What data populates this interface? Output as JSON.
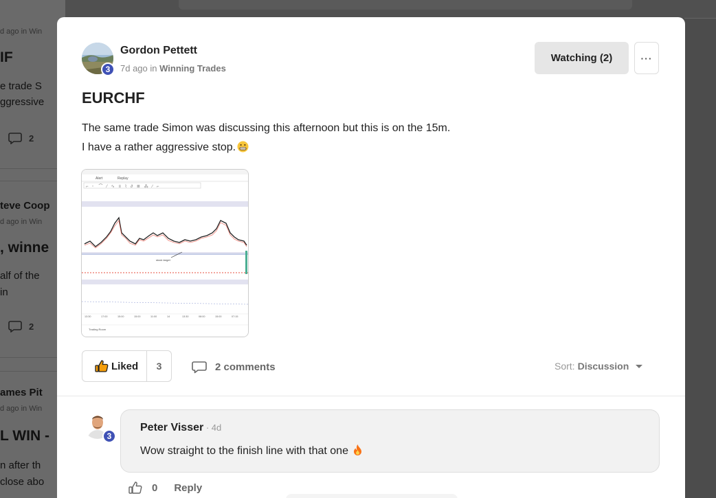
{
  "background_feed": {
    "cards": [
      {
        "meta": "d ago in Win",
        "title": "IF",
        "lines": [
          "e trade S",
          "ggressive"
        ],
        "comments": "2"
      },
      {
        "name": "teve Coop",
        "meta": "d ago in Win",
        "title": ", winne",
        "lines": [
          "alf of the",
          "in"
        ],
        "comments": "2"
      },
      {
        "name": "ames Pit",
        "meta": "d ago in Win",
        "title": "L WIN -",
        "lines": [
          "n after th",
          "close abo"
        ]
      }
    ]
  },
  "post": {
    "author": "Gordon Pettett",
    "level": "3",
    "time": "7d ago in",
    "group": "Winning Trades",
    "title": "EURCHF",
    "body_lines": [
      "The same trade Simon was discussing this afternoon but this is on the 15m.",
      "I have a rather aggressive stop."
    ]
  },
  "header_actions": {
    "watching_label": "Watching (2)",
    "more_icon": "ellipsis-icon"
  },
  "chart_preview": {
    "toolbar_items": [
      "Alert",
      "Replay"
    ],
    "annotation": "stock target",
    "footer_label": "Trading Room",
    "x_ticks": [
      "13:30",
      "17:00",
      "15:00",
      "15:00",
      "11:00",
      "14",
      "13:30",
      "08:00",
      "15:00",
      "07:15"
    ]
  },
  "reactions": {
    "liked_label": "Liked",
    "liked_count": "3",
    "comments_label": "2 comments",
    "sort_prefix": "Sort:",
    "sort_value": "Discussion"
  },
  "comment": {
    "author": "Peter Visser",
    "level": "3",
    "time": " · 4d",
    "text": "Wow straight to the finish line with that one",
    "like_count": "0",
    "reply_label": "Reply"
  },
  "colors": {
    "badge": "#3f51b5",
    "like_icon": "#f59e0b"
  }
}
